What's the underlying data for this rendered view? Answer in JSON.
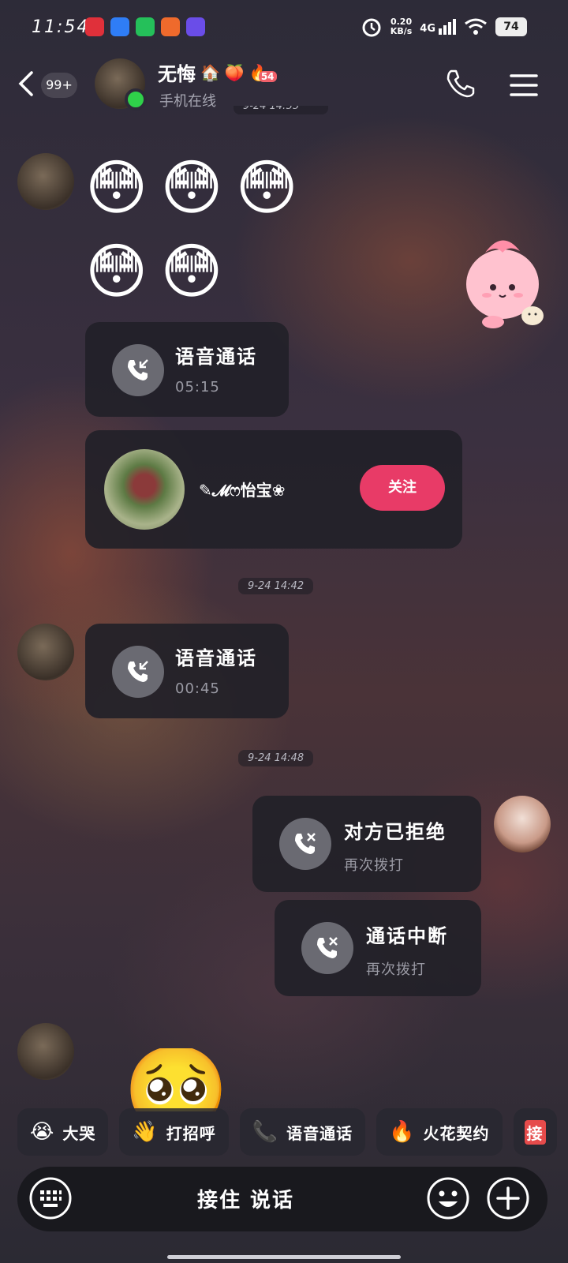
{
  "status_bar": {
    "time": "11:54",
    "net_speed_value": "0.20",
    "net_speed_unit": "KB/s",
    "network": "4G",
    "battery": "74"
  },
  "header": {
    "unread_count": "99+",
    "contact_name": "无悔",
    "contact_badges": [
      "🏠",
      "🍑",
      "🔥"
    ],
    "streak_count": "54",
    "online_status": "手机在线"
  },
  "messages": {
    "top_time_fragment": "9-24 14:55",
    "emoji_row1": [
      "😳",
      "😳",
      "😳"
    ],
    "emoji_row2": [
      "😳",
      "😳"
    ],
    "voice_call_1": {
      "title": "语音通话",
      "duration": "05:15"
    },
    "profile_card": {
      "name": "✎𝓜ෆ怡宝❀",
      "follow_label": "关注"
    },
    "time_1": "9-24 14:42",
    "voice_call_2": {
      "title": "语音通话",
      "duration": "00:45"
    },
    "time_2": "9-24 14:48",
    "rejected_call": {
      "title": "对方已拒绝",
      "action": "再次拨打"
    },
    "interrupted_call": {
      "title": "通话中断",
      "action": "再次拨打"
    },
    "last_emoji": "🥺"
  },
  "quick_actions": [
    {
      "icon": "😭",
      "label": "大哭"
    },
    {
      "icon": "👋",
      "label": "打招呼"
    },
    {
      "icon": "📞",
      "label": "语音通话"
    },
    {
      "icon": "🔥",
      "label": "火花契约"
    },
    {
      "icon": "",
      "label": "接"
    }
  ],
  "input_bar": {
    "hold_to_talk": "接住 说话"
  },
  "colors": {
    "follow": "#e83b67",
    "online": "#2fd14a"
  }
}
